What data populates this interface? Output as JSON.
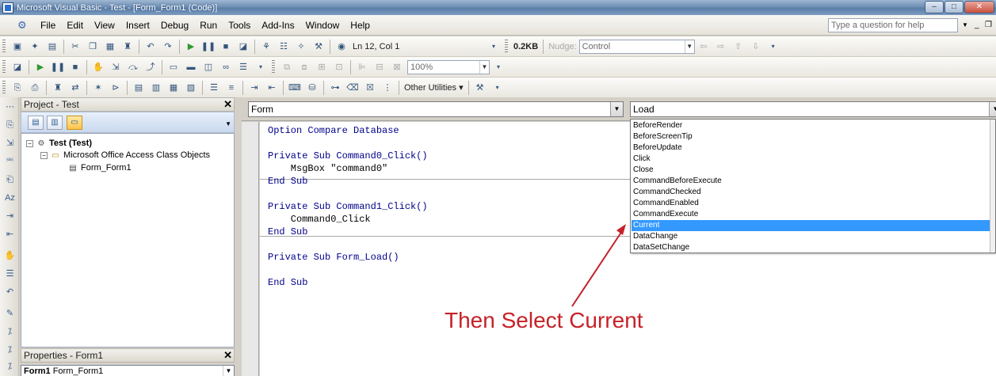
{
  "window": {
    "title": "Microsoft Visual Basic - Test - [Form_Form1 (Code)]",
    "buttons": {
      "minimize": "–",
      "maximize": "□",
      "close": "✕"
    }
  },
  "menubar": {
    "items": [
      {
        "label": "File",
        "key": "F"
      },
      {
        "label": "Edit",
        "key": "E"
      },
      {
        "label": "View",
        "key": "V"
      },
      {
        "label": "Insert",
        "key": "I"
      },
      {
        "label": "Debug",
        "key": "D"
      },
      {
        "label": "Run",
        "key": "R"
      },
      {
        "label": "Tools",
        "key": "T"
      },
      {
        "label": "Add-Ins",
        "key": "A"
      },
      {
        "label": "Window",
        "key": "W"
      },
      {
        "label": "Help",
        "key": "H"
      }
    ],
    "help_placeholder": "Type a question for help"
  },
  "toolbar1": {
    "position_text": "Ln 12, Col 1",
    "size_text": "0.2KB",
    "nudge_label": "Nudge:",
    "nudge_value": "Control"
  },
  "toolbar2": {
    "zoom_value": "100%"
  },
  "toolbar3": {
    "other_utilities_label": "Other Utilities"
  },
  "project_pane": {
    "title": "Project - Test",
    "tree": {
      "root": "Test (Test)",
      "folder": "Microsoft Office Access Class Objects",
      "module": "Form_Form1"
    }
  },
  "properties_pane": {
    "title": "Properties - Form1",
    "object_name": "Form1",
    "object_type": "Form_Form1"
  },
  "code_window": {
    "object_combo": "Form",
    "procedure_combo": "Load",
    "lines": [
      "Option Compare Database",
      "",
      "Private Sub Command0_Click()",
      "    MsgBox \"command0\"",
      "End Sub",
      "",
      "Private Sub Command1_Click()",
      "    Command0_Click",
      "End Sub",
      "",
      "Private Sub Form_Load()",
      "",
      "End Sub"
    ]
  },
  "procedure_list": {
    "items": [
      "BeforeRender",
      "BeforeScreenTip",
      "BeforeUpdate",
      "Click",
      "Close",
      "CommandBeforeExecute",
      "CommandChecked",
      "CommandEnabled",
      "CommandExecute",
      "Current",
      "DataChange",
      "DataSetChange"
    ],
    "selected": "Current"
  },
  "annotation": {
    "text": "Then Select Current",
    "color": "#c62128"
  },
  "colors": {
    "selection": "#3399ff",
    "keyword": "#00008b"
  }
}
